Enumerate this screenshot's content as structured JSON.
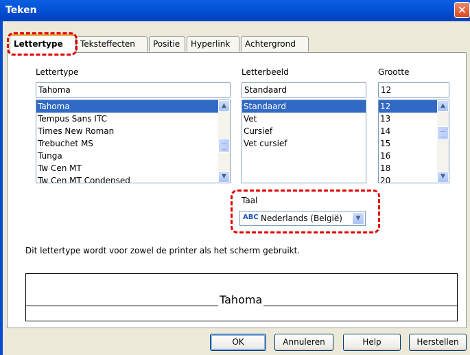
{
  "dialog": {
    "title": "Teken",
    "close_glyph": "✕"
  },
  "tabs": [
    {
      "label": "Lettertype",
      "active": true
    },
    {
      "label": "Teksteffecten"
    },
    {
      "label": "Positie"
    },
    {
      "label": "Hyperlink"
    },
    {
      "label": "Achtergrond"
    }
  ],
  "font_family": {
    "label": "Lettertype",
    "value": "Tahoma",
    "options": [
      "Tahoma",
      "Tempus Sans ITC",
      "Times New Roman",
      "Trebuchet MS",
      "Tunga",
      "Tw Cen MT",
      "Tw Cen MT Condensed"
    ],
    "selected": "Tahoma"
  },
  "font_style": {
    "label": "Letterbeeld",
    "value": "Standaard",
    "options": [
      "Standaard",
      "Vet",
      "Cursief",
      "Vet cursief"
    ],
    "selected": "Standaard"
  },
  "font_size": {
    "label": "Grootte",
    "value": "12",
    "options": [
      "12",
      "13",
      "14",
      "15",
      "16",
      "18",
      "20"
    ],
    "selected": "12"
  },
  "language": {
    "label": "Taal",
    "value": "Nederlands (België)",
    "icon": "spellcheck-icon",
    "icon_text": "ABC"
  },
  "info_text": "Dit lettertype wordt voor zowel de printer als het scherm gebruikt.",
  "preview": {
    "sample": "Tahoma"
  },
  "buttons": {
    "ok": "OK",
    "cancel": "Annuleren",
    "help": "Help",
    "reset": "Herstellen"
  },
  "colors": {
    "title_bar": "#0453d6",
    "selection": "#316ac5",
    "highlight": "#e00000",
    "tab_accent": "#e69a2d"
  }
}
